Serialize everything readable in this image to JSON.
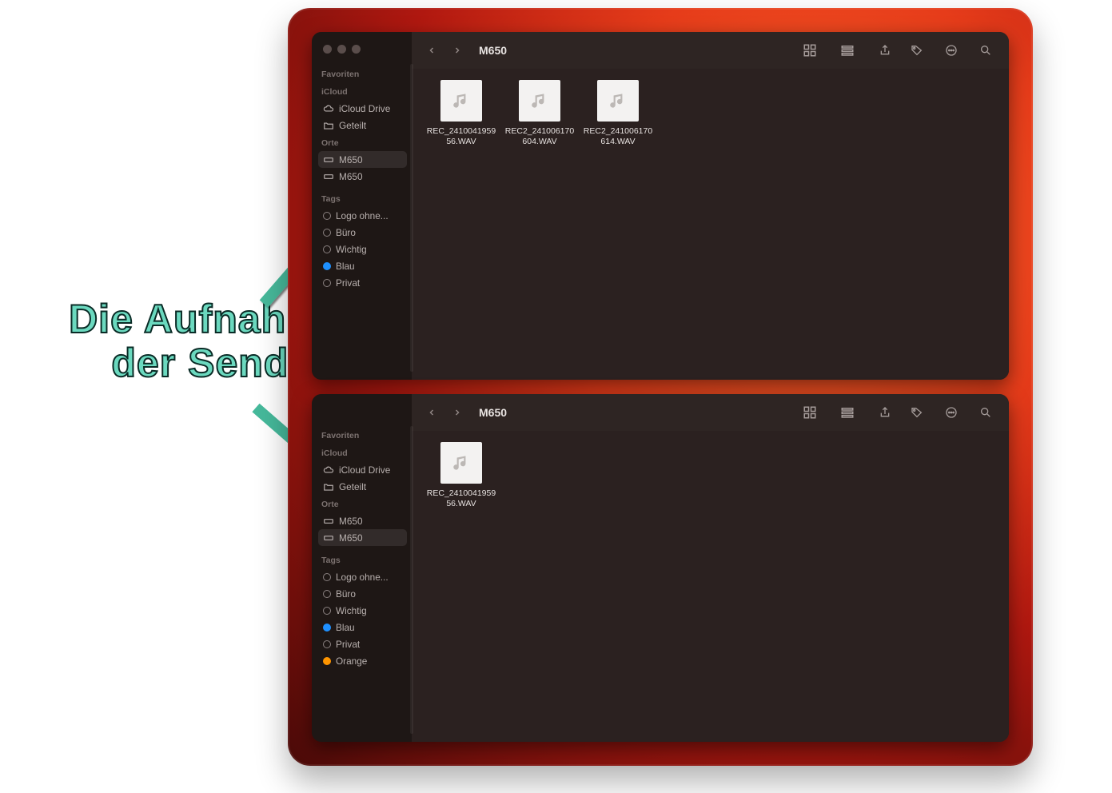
{
  "annotation": {
    "line1": "Die Aufnahmen",
    "line2": "der Sender"
  },
  "windows": [
    {
      "title": "M650",
      "sidebar": {
        "favoriten_label": "Favoriten",
        "icloud_label": "iCloud",
        "icloud_items": [
          "iCloud Drive",
          "Geteilt"
        ],
        "orte_label": "Orte",
        "orte_items": [
          "M650",
          "M650"
        ],
        "tags_label": "Tags",
        "tags": [
          {
            "label": "Logo ohne...",
            "color": ""
          },
          {
            "label": "Büro",
            "color": ""
          },
          {
            "label": "Wichtig",
            "color": ""
          },
          {
            "label": "Blau",
            "color": "blue"
          },
          {
            "label": "Privat",
            "color": ""
          }
        ]
      },
      "files": [
        {
          "name": "REC_2410041959\n56.WAV"
        },
        {
          "name": "REC2_241006170\n604.WAV"
        },
        {
          "name": "REC2_241006170\n614.WAV"
        }
      ]
    },
    {
      "title": "M650",
      "sidebar": {
        "favoriten_label": "Favoriten",
        "icloud_label": "iCloud",
        "icloud_items": [
          "iCloud Drive",
          "Geteilt"
        ],
        "orte_label": "Orte",
        "orte_items": [
          "M650",
          "M650"
        ],
        "tags_label": "Tags",
        "tags": [
          {
            "label": "Logo ohne...",
            "color": ""
          },
          {
            "label": "Büro",
            "color": ""
          },
          {
            "label": "Wichtig",
            "color": ""
          },
          {
            "label": "Blau",
            "color": "blue"
          },
          {
            "label": "Privat",
            "color": ""
          },
          {
            "label": "Orange",
            "color": "orange"
          }
        ]
      },
      "files": [
        {
          "name": "REC_2410041959\n56.WAV"
        }
      ]
    }
  ]
}
